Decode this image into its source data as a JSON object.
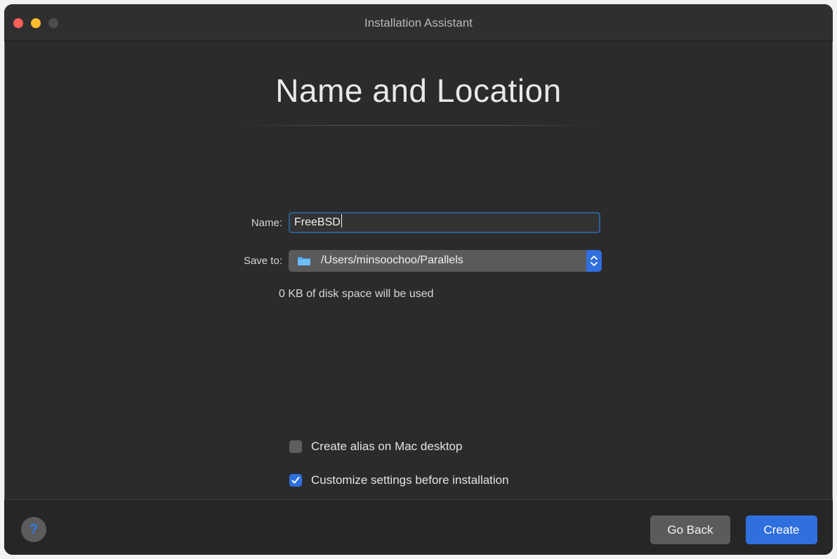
{
  "window": {
    "title": "Installation Assistant"
  },
  "page": {
    "heading": "Name and Location"
  },
  "form": {
    "name_label": "Name:",
    "name_value": "FreeBSD",
    "save_to_label": "Save to:",
    "save_to_value": "/Users/minsoochoo/Parallels",
    "disk_info": "0 KB of disk space will be used"
  },
  "options": [
    {
      "label": "Create alias on Mac desktop",
      "checked": false
    },
    {
      "label": "Customize settings before installation",
      "checked": true
    }
  ],
  "footer": {
    "help_label": "?",
    "back_label": "Go Back",
    "create_label": "Create"
  },
  "colors": {
    "accent": "#2f6fde",
    "window_bg": "#2b2b2b",
    "close": "#fe5f57",
    "minimize": "#febc2e"
  },
  "icons": [
    "folder-icon",
    "stepper-icon",
    "checkmark-icon"
  ]
}
